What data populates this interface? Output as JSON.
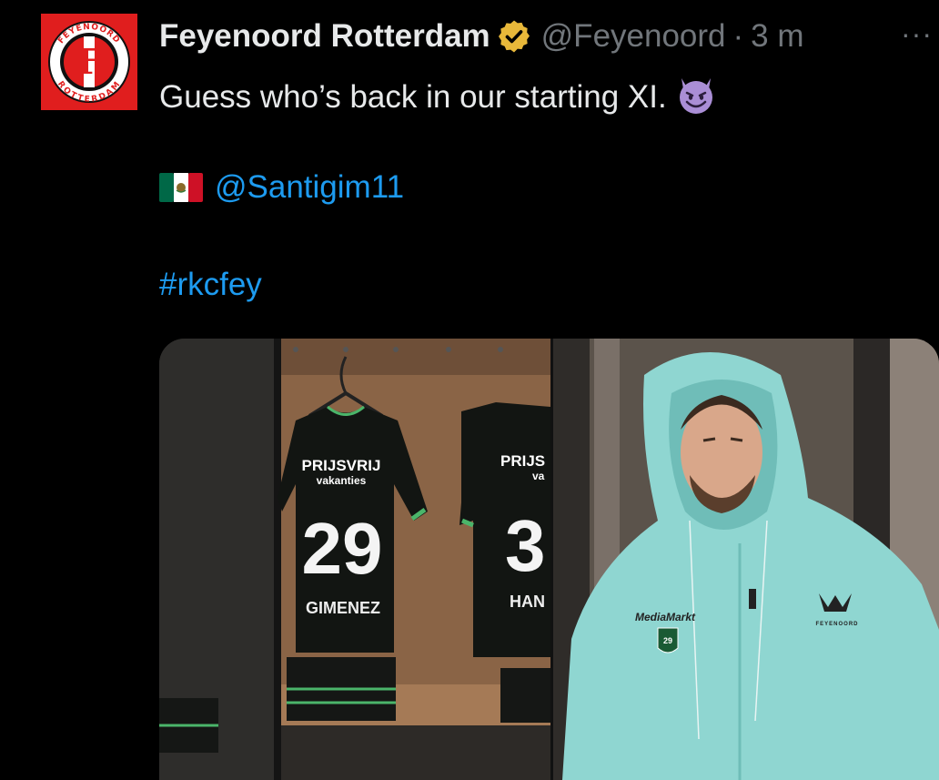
{
  "tweet": {
    "author_name": "Feyenoord Rotterdam",
    "handle": "@Feyenoord",
    "separator": "·",
    "time": "3 m",
    "more_label": "···",
    "line1": "Guess who’s back in our starting XI.",
    "mention": "@Santigim11",
    "hashtag": "#rkcfey"
  },
  "avatar": {
    "logo_letter": "F",
    "logo_top_text": "FEYENOORD",
    "logo_bottom_text": "ROTTERDAM"
  },
  "media": {
    "left": {
      "shirt_sponsor": "PRIJSVRIJ",
      "shirt_sponsor_sub": "vakanties",
      "shirt_number": "29",
      "shirt_name": "GIMENEZ",
      "shirt2_sponsor": "PRIJS",
      "shirt2_sponsor_sub": "va",
      "shirt2_number": "3",
      "shirt2_name": "HAN"
    },
    "right": {
      "chest_sponsor": "MediaMarkt",
      "badge_number": "29",
      "brand_text": "FEYENOORD"
    }
  },
  "icons": {
    "verified": "verified-badge-icon",
    "emoji": "smiling-devil-emoji",
    "flag": "mexico-flag-emoji",
    "more": "more-options-icon"
  },
  "colors": {
    "background": "#000000",
    "text": "#e7e9ea",
    "muted": "#71767b",
    "link": "#1d9bf0",
    "verified_gold": "#e8b83a",
    "avatar_red": "#e01e1e",
    "hoodie": "#8fd6d1"
  }
}
